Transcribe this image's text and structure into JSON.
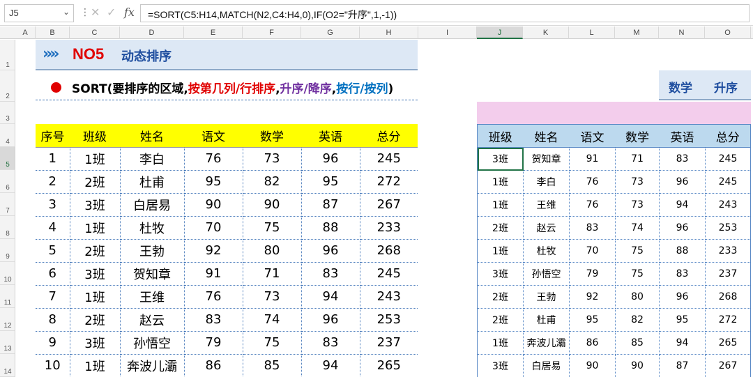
{
  "namebox": {
    "value": "J5"
  },
  "formula_bar": {
    "fx_label": "fx",
    "formula": "=SORT(C5:H14,MATCH(N2,C4:H4,0),IF(O2=\"升序\",1,-1))"
  },
  "column_headers": [
    "A",
    "B",
    "C",
    "D",
    "E",
    "F",
    "G",
    "H",
    "I",
    "J",
    "K",
    "L",
    "M",
    "N",
    "O"
  ],
  "row_headers": [
    "1",
    "2",
    "3",
    "4",
    "5",
    "6",
    "7",
    "8",
    "9",
    "10",
    "11",
    "12",
    "13",
    "14"
  ],
  "banner": {
    "chevrons": "»»",
    "code": "NO5",
    "title": "动态排序"
  },
  "syntax": {
    "prefix": "SORT(要排序的区域,",
    "part1": "按第几列/行排序",
    "comma1": ",",
    "part2": "升序/降序",
    "comma2": ",",
    "part3": "按行/按列",
    "suffix": ")",
    "colors": {
      "prefix": "#000000",
      "part1": "#e00000",
      "part2": "#7030a0",
      "part3": "#0070c0"
    }
  },
  "left_table": {
    "headers": [
      "序号",
      "班级",
      "姓名",
      "语文",
      "数学",
      "英语",
      "总分"
    ],
    "rows": [
      [
        "1",
        "1班",
        "李白",
        "76",
        "73",
        "96",
        "245"
      ],
      [
        "2",
        "2班",
        "杜甫",
        "95",
        "82",
        "95",
        "272"
      ],
      [
        "3",
        "3班",
        "白居易",
        "90",
        "90",
        "87",
        "267"
      ],
      [
        "4",
        "1班",
        "杜牧",
        "70",
        "75",
        "88",
        "233"
      ],
      [
        "5",
        "2班",
        "王勃",
        "92",
        "80",
        "96",
        "268"
      ],
      [
        "6",
        "3班",
        "贺知章",
        "91",
        "71",
        "83",
        "245"
      ],
      [
        "7",
        "1班",
        "王维",
        "76",
        "73",
        "94",
        "243"
      ],
      [
        "8",
        "2班",
        "赵云",
        "83",
        "74",
        "96",
        "253"
      ],
      [
        "9",
        "3班",
        "孙悟空",
        "79",
        "75",
        "83",
        "237"
      ],
      [
        "10",
        "1班",
        "奔波儿灞",
        "86",
        "85",
        "94",
        "265"
      ]
    ]
  },
  "right_header": {
    "subject": "数学",
    "order": "升序"
  },
  "right_table": {
    "headers": [
      "班级",
      "姓名",
      "语文",
      "数学",
      "英语",
      "总分"
    ],
    "rows": [
      [
        "3班",
        "贺知章",
        "91",
        "71",
        "83",
        "245"
      ],
      [
        "1班",
        "李白",
        "76",
        "73",
        "96",
        "245"
      ],
      [
        "1班",
        "王维",
        "76",
        "73",
        "94",
        "243"
      ],
      [
        "2班",
        "赵云",
        "83",
        "74",
        "96",
        "253"
      ],
      [
        "1班",
        "杜牧",
        "70",
        "75",
        "88",
        "233"
      ],
      [
        "3班",
        "孙悟空",
        "79",
        "75",
        "83",
        "237"
      ],
      [
        "2班",
        "王勃",
        "92",
        "80",
        "96",
        "268"
      ],
      [
        "2班",
        "杜甫",
        "95",
        "82",
        "95",
        "272"
      ],
      [
        "1班",
        "奔波儿灞",
        "86",
        "85",
        "94",
        "265"
      ],
      [
        "3班",
        "白居易",
        "90",
        "90",
        "87",
        "267"
      ]
    ]
  }
}
